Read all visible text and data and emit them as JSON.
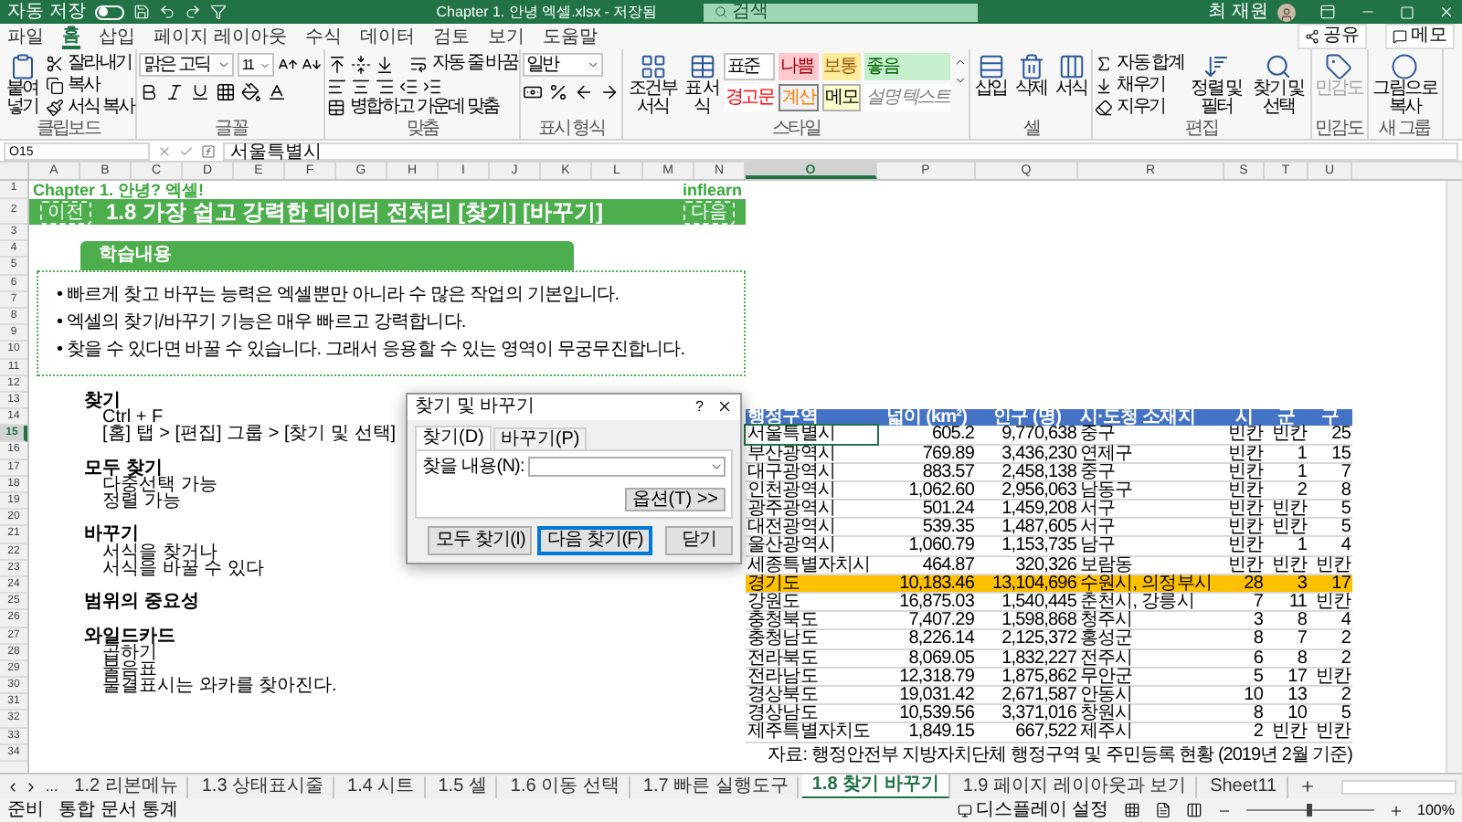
{
  "title_bar": {
    "autosave": {
      "label": "자동 저장",
      "on": false
    },
    "title": "Chapter 1. 안녕 엑셀.xlsx - 저장됨",
    "search": {
      "placeholder": "검색"
    },
    "user": "최 재원"
  },
  "menu_tabs": [
    {
      "label": "파일",
      "selected": false
    },
    {
      "label": "홈",
      "selected": true
    },
    {
      "label": "삽입",
      "selected": false
    },
    {
      "label": "페이지 레이아웃",
      "selected": false
    },
    {
      "label": "수식",
      "selected": false
    },
    {
      "label": "데이터",
      "selected": false
    },
    {
      "label": "검토",
      "selected": false
    },
    {
      "label": "보기",
      "selected": false
    },
    {
      "label": "도움말",
      "selected": false
    }
  ],
  "menu_actions": {
    "share": "공유",
    "comments": "메모"
  },
  "ribbon": {
    "clipboard": {
      "paste": "붙여넣기",
      "cut": "잘라내기",
      "copy": "복사",
      "format_painter": "서식 복사",
      "label": "클립보드"
    },
    "font": {
      "name": "맑은 고딕",
      "size": "11",
      "label": "글꼴"
    },
    "alignment": {
      "wrap": "자동 줄 바꿈",
      "merge": "병합하고 가운데 맞춤",
      "label": "맞춤"
    },
    "number": {
      "format": "일반",
      "label": "표시 형식"
    },
    "styles": {
      "conditional": "조건부 서식",
      "table": "표 서식",
      "cells": [
        {
          "label": "표준",
          "kind": "normal"
        },
        {
          "label": "나쁨",
          "kind": "bad"
        },
        {
          "label": "보통",
          "kind": "neutral"
        },
        {
          "label": "좋음",
          "kind": "good"
        },
        {
          "label": "경고문",
          "kind": "warning"
        },
        {
          "label": "계산",
          "kind": "calculation"
        },
        {
          "label": "메모",
          "kind": "note"
        },
        {
          "label": "설명 텍스트",
          "kind": "explanatory"
        }
      ],
      "label": "스타일"
    },
    "cells": {
      "buttons": [
        "삽입",
        "삭제",
        "서식"
      ],
      "label": "셀"
    },
    "editing": {
      "autosum": "자동 합계",
      "fill": "채우기",
      "clear": "지우기",
      "sort": "정렬 및 필터",
      "find": "찾기 및 선택",
      "label": "편집"
    },
    "sensitivity": {
      "button": "민감도",
      "disabled": true,
      "label": "민감도"
    },
    "new_group": {
      "button": "그림으로 복사",
      "label": "새 그룹"
    }
  },
  "formula_bar": {
    "name_box": "O15",
    "value": "서울특별시"
  },
  "columns": [
    {
      "label": "A",
      "selected": false
    },
    {
      "label": "B",
      "selected": false
    },
    {
      "label": "C",
      "selected": false
    },
    {
      "label": "D",
      "selected": false
    },
    {
      "label": "E",
      "selected": false
    },
    {
      "label": "F",
      "selected": false
    },
    {
      "label": "G",
      "selected": false
    },
    {
      "label": "H",
      "selected": false
    },
    {
      "label": "I",
      "selected": false
    },
    {
      "label": "J",
      "selected": false
    },
    {
      "label": "K",
      "selected": false
    },
    {
      "label": "L",
      "selected": false
    },
    {
      "label": "M",
      "selected": false
    },
    {
      "label": "N",
      "selected": false
    },
    {
      "label": "O",
      "selected": true
    },
    {
      "label": "P",
      "selected": false
    },
    {
      "label": "Q",
      "selected": false
    },
    {
      "label": "R",
      "selected": false
    },
    {
      "label": "S",
      "selected": false
    },
    {
      "label": "T",
      "selected": false
    },
    {
      "label": "U",
      "selected": false
    }
  ],
  "rows": [
    {
      "label": "1",
      "selected": false
    },
    {
      "label": "2",
      "selected": false
    },
    {
      "label": "3",
      "selected": false
    },
    {
      "label": "4",
      "selected": false
    },
    {
      "label": "5",
      "selected": false
    },
    {
      "label": "6",
      "selected": false
    },
    {
      "label": "7",
      "selected": false
    },
    {
      "label": "8",
      "selected": false
    },
    {
      "label": "9",
      "selected": false
    },
    {
      "label": "10",
      "selected": false
    },
    {
      "label": "11",
      "selected": false
    },
    {
      "label": "12",
      "selected": false
    },
    {
      "label": "13",
      "selected": false
    },
    {
      "label": "14",
      "selected": false
    },
    {
      "label": "15",
      "selected": true
    },
    {
      "label": "16",
      "selected": false
    },
    {
      "label": "17",
      "selected": false
    },
    {
      "label": "18",
      "selected": false
    },
    {
      "label": "19",
      "selected": false
    },
    {
      "label": "20",
      "selected": false
    },
    {
      "label": "21",
      "selected": false
    },
    {
      "label": "22",
      "selected": false
    },
    {
      "label": "23",
      "selected": false
    },
    {
      "label": "24",
      "selected": false
    },
    {
      "label": "25",
      "selected": false
    },
    {
      "label": "26",
      "selected": false
    },
    {
      "label": "27",
      "selected": false
    },
    {
      "label": "28",
      "selected": false
    },
    {
      "label": "29",
      "selected": false
    },
    {
      "label": "30",
      "selected": false
    },
    {
      "label": "31",
      "selected": false
    },
    {
      "label": "32",
      "selected": false
    },
    {
      "label": "33",
      "selected": false
    },
    {
      "label": "34",
      "selected": false
    }
  ],
  "sheet": {
    "chapter": "Chapter 1. 안녕? 엑셀!",
    "logo": "inflearn",
    "banner": {
      "prev": "이전",
      "title": "1.8 가장 쉽고 강력한 데이터 전처리 [찾기] [바꾸기]",
      "next": "다음"
    },
    "learning": {
      "title": "학습내용",
      "bullet": "•",
      "bullets": [
        "빠르게 찾고 바꾸는 능력은 엑셀뿐만 아니라 수 많은 작업의 기본입니다.",
        "엑셀의 찾기/바꾸기 기능은 매우 빠르고 강력합니다.",
        "찾을 수 있다면 바꿀 수 있습니다. 그래서 응용할 수 있는 영역이 무궁무진합니다."
      ]
    },
    "notes": [
      {
        "title": "찾기",
        "items": [
          "Ctrl + F",
          "[홈] 탭 > [편집] 그룹 > [찾기 및 선택]"
        ]
      },
      {
        "title": "모두 찾기",
        "items": [
          "다중선택 가능",
          "정렬 가능"
        ]
      },
      {
        "title": "바꾸기",
        "items": [
          "서식을 찾거나",
          "서식을 바꿀 수 있다"
        ]
      },
      {
        "title": "범위의 중요성"
      },
      {
        "title": "와일드카드",
        "items": [
          "곱하기",
          "물음표",
          "물결표시는 와카를 찾아진다."
        ]
      }
    ]
  },
  "table": {
    "columns": [
      "행정구역",
      "넓이 (km²)",
      "인구 (명)",
      "시·도청 소재지",
      "시",
      "군",
      "구"
    ],
    "rows": [
      {
        "cells": [
          "서울특별시",
          "605.2",
          "9,770,638",
          "중구",
          "빈칸",
          "빈칸",
          "25"
        ],
        "highlighted": false,
        "active_cell": true
      },
      {
        "cells": [
          "부산광역시",
          "769.89",
          "3,436,230",
          "연제구",
          "빈칸",
          "1",
          "15"
        ],
        "highlighted": false,
        "active_cell": false
      },
      {
        "cells": [
          "대구광역시",
          "883.57",
          "2,458,138",
          "중구",
          "빈칸",
          "1",
          "7"
        ],
        "highlighted": false,
        "active_cell": false
      },
      {
        "cells": [
          "인천광역시",
          "1,062.60",
          "2,956,063",
          "남동구",
          "빈칸",
          "2",
          "8"
        ],
        "highlighted": false,
        "active_cell": false
      },
      {
        "cells": [
          "광주광역시",
          "501.24",
          "1,459,208",
          "서구",
          "빈칸",
          "빈칸",
          "5"
        ],
        "highlighted": false,
        "active_cell": false
      },
      {
        "cells": [
          "대전광역시",
          "539.35",
          "1,487,605",
          "서구",
          "빈칸",
          "빈칸",
          "5"
        ],
        "highlighted": false,
        "active_cell": false
      },
      {
        "cells": [
          "울산광역시",
          "1,060.79",
          "1,153,735",
          "남구",
          "빈칸",
          "1",
          "4"
        ],
        "highlighted": false,
        "active_cell": false
      },
      {
        "cells": [
          "세종특별자치시",
          "464.87",
          "320,326",
          "보람동",
          "빈칸",
          "빈칸",
          "빈칸"
        ],
        "highlighted": false,
        "active_cell": false
      },
      {
        "cells": [
          "경기도",
          "10,183.46",
          "13,104,696",
          "수원시, 의정부시",
          "28",
          "3",
          "17"
        ],
        "highlighted": true,
        "active_cell": false
      },
      {
        "cells": [
          "강원도",
          "16,875.03",
          "1,540,445",
          "춘천시, 강릉시",
          "7",
          "11",
          "빈칸"
        ],
        "highlighted": false,
        "active_cell": false
      },
      {
        "cells": [
          "충청북도",
          "7,407.29",
          "1,598,868",
          "청주시",
          "3",
          "8",
          "4"
        ],
        "highlighted": false,
        "active_cell": false
      },
      {
        "cells": [
          "충청남도",
          "8,226.14",
          "2,125,372",
          "홍성군",
          "8",
          "7",
          "2"
        ],
        "highlighted": false,
        "active_cell": false
      },
      {
        "cells": [
          "전라북도",
          "8,069.05",
          "1,832,227",
          "전주시",
          "6",
          "8",
          "2"
        ],
        "highlighted": false,
        "active_cell": false
      },
      {
        "cells": [
          "전라남도",
          "12,318.79",
          "1,875,862",
          "무안군",
          "5",
          "17",
          "빈칸"
        ],
        "highlighted": false,
        "active_cell": false
      },
      {
        "cells": [
          "경상북도",
          "19,031.42",
          "2,671,587",
          "안동시",
          "10",
          "13",
          "2"
        ],
        "highlighted": false,
        "active_cell": false
      },
      {
        "cells": [
          "경상남도",
          "10,539.56",
          "3,371,016",
          "창원시",
          "8",
          "10",
          "5"
        ],
        "highlighted": false,
        "active_cell": false
      },
      {
        "cells": [
          "제주특별자치도",
          "1,849.15",
          "667,522",
          "제주시",
          "2",
          "빈칸",
          "빈칸"
        ],
        "highlighted": false,
        "active_cell": false
      }
    ],
    "source": "자료: 행정안전부 지방자치단체 행정구역 및 주민등록 현황 (2019년 2월 기준)"
  },
  "dialog": {
    "title": "찾기 및 바꾸기",
    "help": "?",
    "tabs": [
      {
        "label": "찾기(D)",
        "selected": true
      },
      {
        "label": "바꾸기(P)",
        "selected": false
      }
    ],
    "find_label": "찾을 내용(N):",
    "options": "옵션(T) >>",
    "buttons": [
      {
        "label": "모두 찾기(I)",
        "default": false
      },
      {
        "label": "다음 찾기(F)",
        "default": true
      },
      {
        "label": "닫기",
        "default": false
      }
    ]
  },
  "sheet_tabs": {
    "more": "...",
    "tabs": [
      {
        "label": "1.2 리본메뉴",
        "selected": false
      },
      {
        "label": "1.3 상태표시줄",
        "selected": false
      },
      {
        "label": "1.4 시트",
        "selected": false
      },
      {
        "label": "1.5 셀",
        "selected": false
      },
      {
        "label": "1.6 이동 선택",
        "selected": false
      },
      {
        "label": "1.7 빠른 실행도구",
        "selected": false
      },
      {
        "label": "1.8 찾기 바꾸기",
        "selected": true
      },
      {
        "label": "1.9 페이지 레이아웃과 보기",
        "selected": false
      },
      {
        "label": "Sheet11",
        "selected": false
      }
    ]
  },
  "status_bar": {
    "ready": "준비",
    "stats": "통합 문서 통계",
    "display": "디스플레이 설정",
    "zoom": {
      "level": 0.5,
      "label": "100%"
    }
  }
}
